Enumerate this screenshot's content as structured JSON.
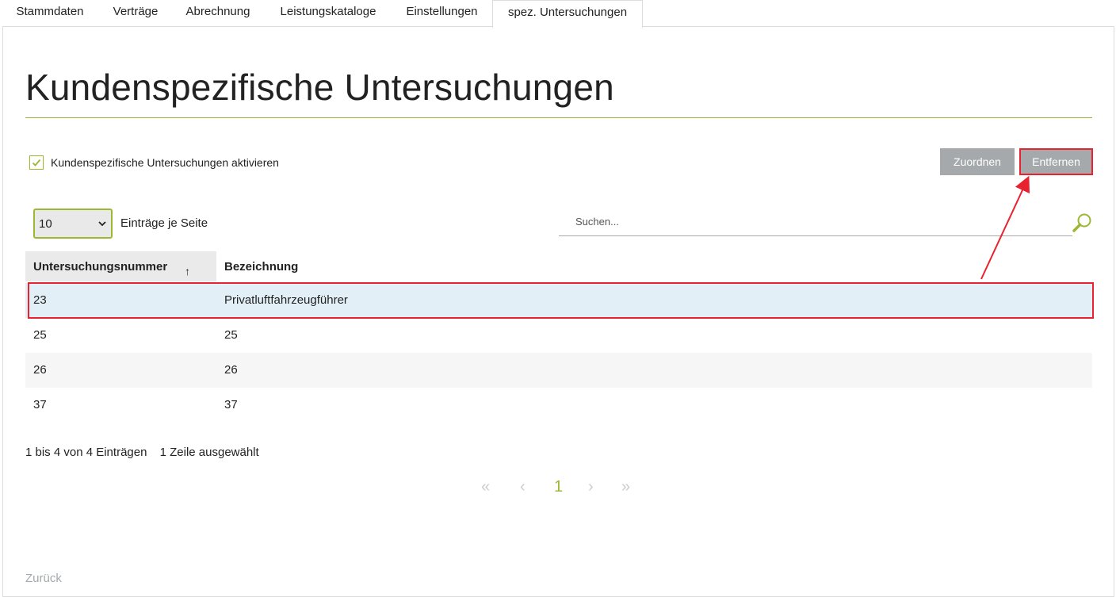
{
  "tabs": [
    {
      "label": "Stammdaten"
    },
    {
      "label": "Verträge"
    },
    {
      "label": "Abrechnung"
    },
    {
      "label": "Leistungskataloge"
    },
    {
      "label": "Einstellungen"
    },
    {
      "label": "spez. Untersuchungen",
      "active": true
    }
  ],
  "page": {
    "title": "Kundenspezifische Untersuchungen",
    "activate_label": "Kundenspezifische Untersuchungen aktivieren",
    "activate_checked": true
  },
  "toolbar": {
    "assign_label": "Zuordnen",
    "remove_label": "Entfernen"
  },
  "paging": {
    "page_size": "10",
    "per_page_label": "Einträge je Seite",
    "search_placeholder": "Suchen...",
    "first": "«",
    "prev": "‹",
    "current": "1",
    "next": "›",
    "last": "»"
  },
  "table": {
    "columns": [
      "Untersuchungsnummer",
      "Bezeichnung"
    ],
    "sort_indicator": "↑",
    "rows": [
      {
        "number": "23",
        "name": "Privatluftfahrzeugführer",
        "selected": true
      },
      {
        "number": "25",
        "name": "25"
      },
      {
        "number": "26",
        "name": "26"
      },
      {
        "number": "37",
        "name": "37"
      }
    ]
  },
  "status": {
    "entries": "1 bis 4 von 4 Einträgen",
    "selection": "1 Zeile ausgewählt"
  },
  "footer": {
    "back_label": "Zurück"
  },
  "colors": {
    "accent": "#9cb833",
    "highlight": "#e8222e",
    "button_gray": "#a5a9ab",
    "selected_row": "#e3eff7"
  }
}
